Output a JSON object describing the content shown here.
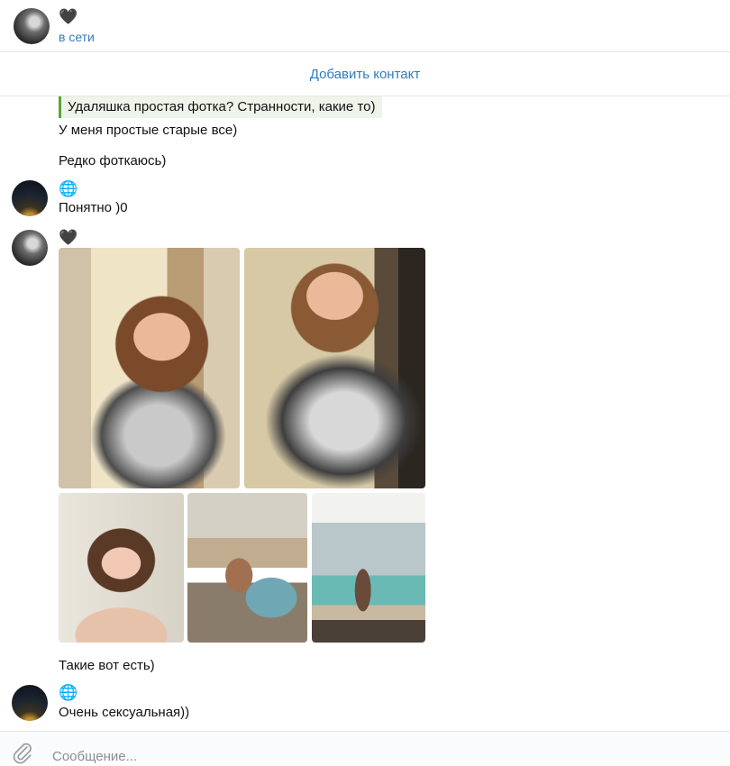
{
  "header": {
    "contact_name": "🖤",
    "status": "в сети"
  },
  "add_contact_label": "Добавить контакт",
  "messages": {
    "quote_text": "Удаляшка простая фотка? Странности, какие то)",
    "m1": "У меня простые старые все)",
    "m2": "Редко фоткаюсь)",
    "sender2_name": "🌐",
    "m3": "Понятно )0",
    "sender1_name": "🖤",
    "m4": "Такие вот есть)",
    "sender2_name_b": "🌐",
    "m5": "Очень сексуальная))"
  },
  "composer": {
    "placeholder": "Сообщение..."
  },
  "icons": {
    "attach": "paperclip-icon",
    "avatar_1": "avatar-dark-grey",
    "avatar_2": "avatar-night-lights"
  },
  "colors": {
    "accent_link": "#2f7cc2",
    "online_status": "#3a7ab8",
    "quote_bar": "#5aa43a",
    "quote_bg": "#eef4ea"
  }
}
